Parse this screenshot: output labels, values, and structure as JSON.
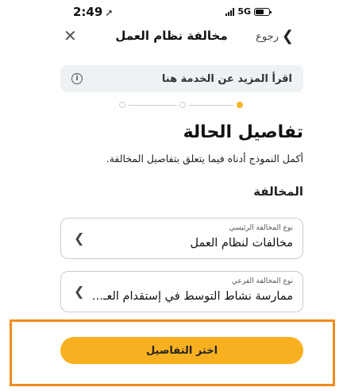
{
  "status_bar": {
    "time": "2:49",
    "network": "5G",
    "battery_level": 0.6
  },
  "header": {
    "back_label": "رجوع",
    "title": "مخالفة نظام العمل"
  },
  "info_banner": {
    "text": "اقرأ المزيد عن الخدمة هنا",
    "icon": "info-icon"
  },
  "stepper": {
    "total_steps": 3,
    "current_step": 1,
    "active_color": "#f5b321",
    "inactive_color": "#c9ced3"
  },
  "case": {
    "title": "تفاصيل الحالة",
    "description": "أكمل النموذج أدناه فيما يتعلق بتفاصيل المخالفة.",
    "subsection": "المخالفة"
  },
  "fields": {
    "main_type": {
      "label": "نوع المخالفة الرئيسي",
      "value": "مخالفات لنظام العمل"
    },
    "sub_type": {
      "label": "نوع المخالفة الفرعي",
      "value": "ممارسة نشاط التوسط في إستقدام العـ…"
    }
  },
  "actions": {
    "primary_label": "اختر التفاصيل",
    "primary_color": "#f8b021",
    "highlight_color": "#f28c1b"
  }
}
